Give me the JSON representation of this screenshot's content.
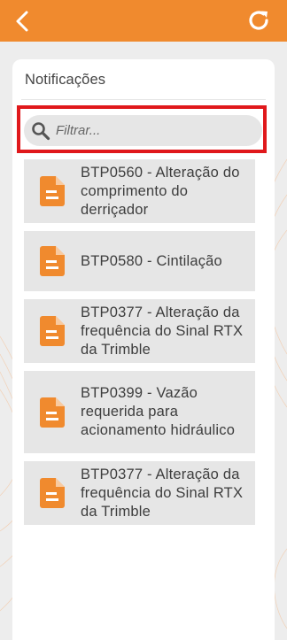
{
  "header": {
    "back_icon": "chevron-left-icon",
    "refresh_icon": "refresh-icon",
    "color": "#f08a2e"
  },
  "card": {
    "title": "Notificações"
  },
  "search": {
    "placeholder": "Filtrar...",
    "icon": "search-icon",
    "highlight_color": "#e0181b"
  },
  "notifications": [
    {
      "title": "BTP0560 - Alteração do comprimento do derriçador",
      "icon": "document-icon"
    },
    {
      "title": "BTP0580 - Cintilação",
      "icon": "document-icon"
    },
    {
      "title": "BTP0377 - Alteração da frequência do Sinal RTX da Trimble",
      "icon": "document-icon"
    },
    {
      "title": "BTP0399 - Vazão requerida para acionamento hidráulico",
      "icon": "document-icon"
    },
    {
      "title": "BTP0377 - Alteração da frequência do Sinal RTX da Trimble",
      "icon": "document-icon"
    }
  ],
  "colors": {
    "accent": "#f08a2e",
    "background": "#ededed",
    "item_background": "#e6e6e6"
  }
}
